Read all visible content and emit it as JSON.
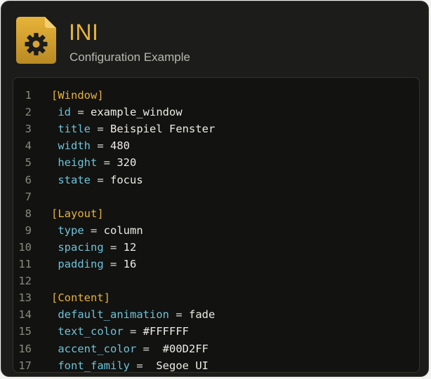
{
  "header": {
    "title": "INI",
    "subtitle": "Configuration Example",
    "icon": "gear-file-icon"
  },
  "colors": {
    "accent": "#e8b339",
    "key": "#6ec2d8",
    "background": "#1c1c1a",
    "code_background": "#121210"
  },
  "lines": [
    {
      "num": "1",
      "type": "section",
      "text": "[Window]"
    },
    {
      "num": "2",
      "type": "kv",
      "key": "id",
      "sep": " = ",
      "value": "example_window"
    },
    {
      "num": "3",
      "type": "kv",
      "key": "title",
      "sep": " = ",
      "value": "Beispiel Fenster"
    },
    {
      "num": "4",
      "type": "kv",
      "key": "width",
      "sep": " = ",
      "value": "480"
    },
    {
      "num": "5",
      "type": "kv",
      "key": "height",
      "sep": " = ",
      "value": "320"
    },
    {
      "num": "6",
      "type": "kv",
      "key": "state",
      "sep": " = ",
      "value": "focus"
    },
    {
      "num": "7",
      "type": "blank"
    },
    {
      "num": "8",
      "type": "section",
      "text": "[Layout]"
    },
    {
      "num": "9",
      "type": "kv",
      "key": "type",
      "sep": " = ",
      "value": "column"
    },
    {
      "num": "10",
      "type": "kv",
      "key": "spacing",
      "sep": " = ",
      "value": "12"
    },
    {
      "num": "11",
      "type": "kv",
      "key": "padding",
      "sep": " = ",
      "value": "16"
    },
    {
      "num": "12",
      "type": "blank"
    },
    {
      "num": "13",
      "type": "section",
      "text": "[Content]"
    },
    {
      "num": "14",
      "type": "kv",
      "key": "default_animation",
      "sep": " = ",
      "value": "fade"
    },
    {
      "num": "15",
      "type": "kv",
      "key": "text_color",
      "sep": " = ",
      "value": "#FFFFFF"
    },
    {
      "num": "16",
      "type": "kv",
      "key": "accent_color",
      "sep": " =  ",
      "value": "#00D2FF"
    },
    {
      "num": "17",
      "type": "kv",
      "key": "font_family",
      "sep": " =  ",
      "value": "Segoe UI"
    }
  ]
}
